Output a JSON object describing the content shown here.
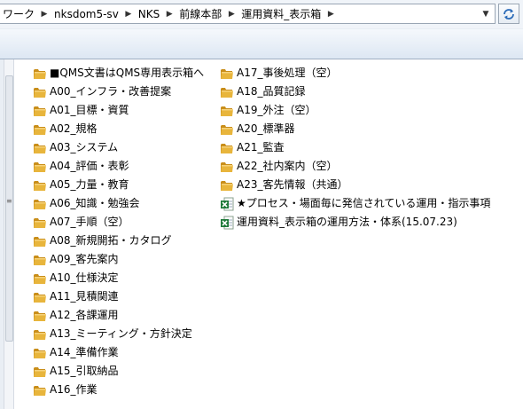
{
  "address_bar": {
    "crumbs": [
      "ワーク",
      "nksdom5-sv",
      "NKS",
      "前線本部",
      "運用資料_表示箱"
    ]
  },
  "folders_col1": [
    "■QMS文書はQMS専用表示箱へ",
    "A00_インフラ・改善提案",
    "A01_目標・資質",
    "A02_規格",
    "A03_システム",
    "A04_評価・表彰",
    "A05_力量・教育",
    "A06_知識・勉強会",
    "A07_手順（空）",
    "A08_新規開拓・カタログ",
    "A09_客先案内",
    "A10_仕様決定",
    "A11_見積関連",
    "A12_各課運用",
    "A13_ミーティング・方針決定",
    "A14_準備作業",
    "A15_引取納品",
    "A16_作業"
  ],
  "folders_col2": [
    "A17_事後処理（空）",
    "A18_品質記録",
    "A19_外注（空）",
    "A20_標準器",
    "A21_監査",
    "A22_社内案内（空）",
    "A23_客先情報（共通）"
  ],
  "files": [
    {
      "name": "★プロセス・場面毎に発信されている運用・指示事項",
      "icon": "excel-file-icon"
    },
    {
      "name": "運用資料_表示箱の運用方法・体系(15.07.23)",
      "icon": "excel-file-icon"
    }
  ],
  "colors": {
    "folder": "#e8b53c",
    "folder_dark": "#c98e1a",
    "excel_green": "#1f7a3a",
    "toolbar_bg": "#dde7f3"
  }
}
